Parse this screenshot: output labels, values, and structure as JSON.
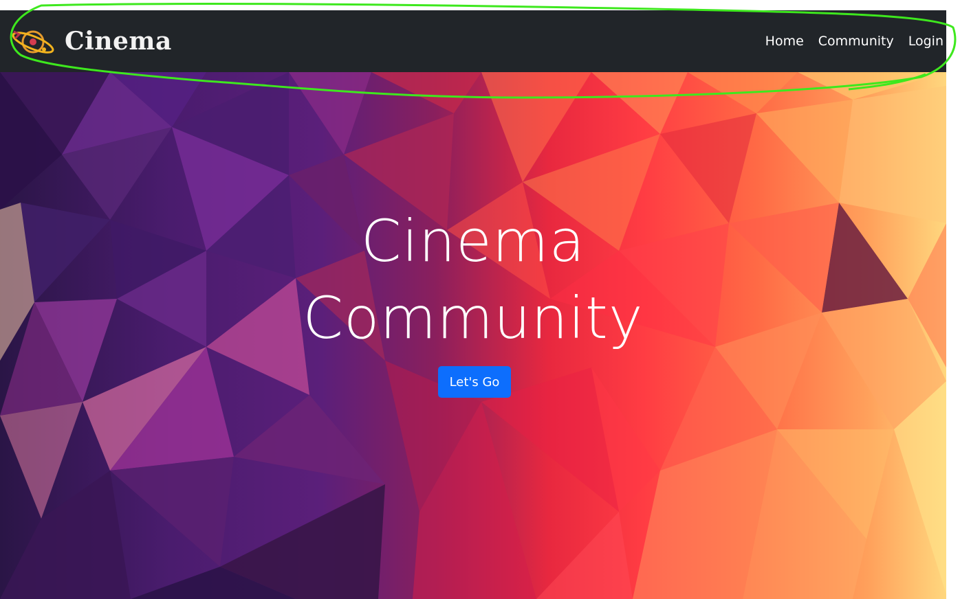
{
  "navbar": {
    "brand_name": "Cinema",
    "logo_icon": "film-reel-orbit-icon",
    "links": [
      {
        "label": "Home"
      },
      {
        "label": "Community"
      },
      {
        "label": "Login"
      }
    ]
  },
  "hero": {
    "title_line1": "Cinema",
    "title_line2": "Community",
    "cta_label": "Let's Go"
  },
  "colors": {
    "navbar_bg": "#212529",
    "cta_bg": "#0d6efd",
    "annotation_stroke": "#3ee81e"
  }
}
